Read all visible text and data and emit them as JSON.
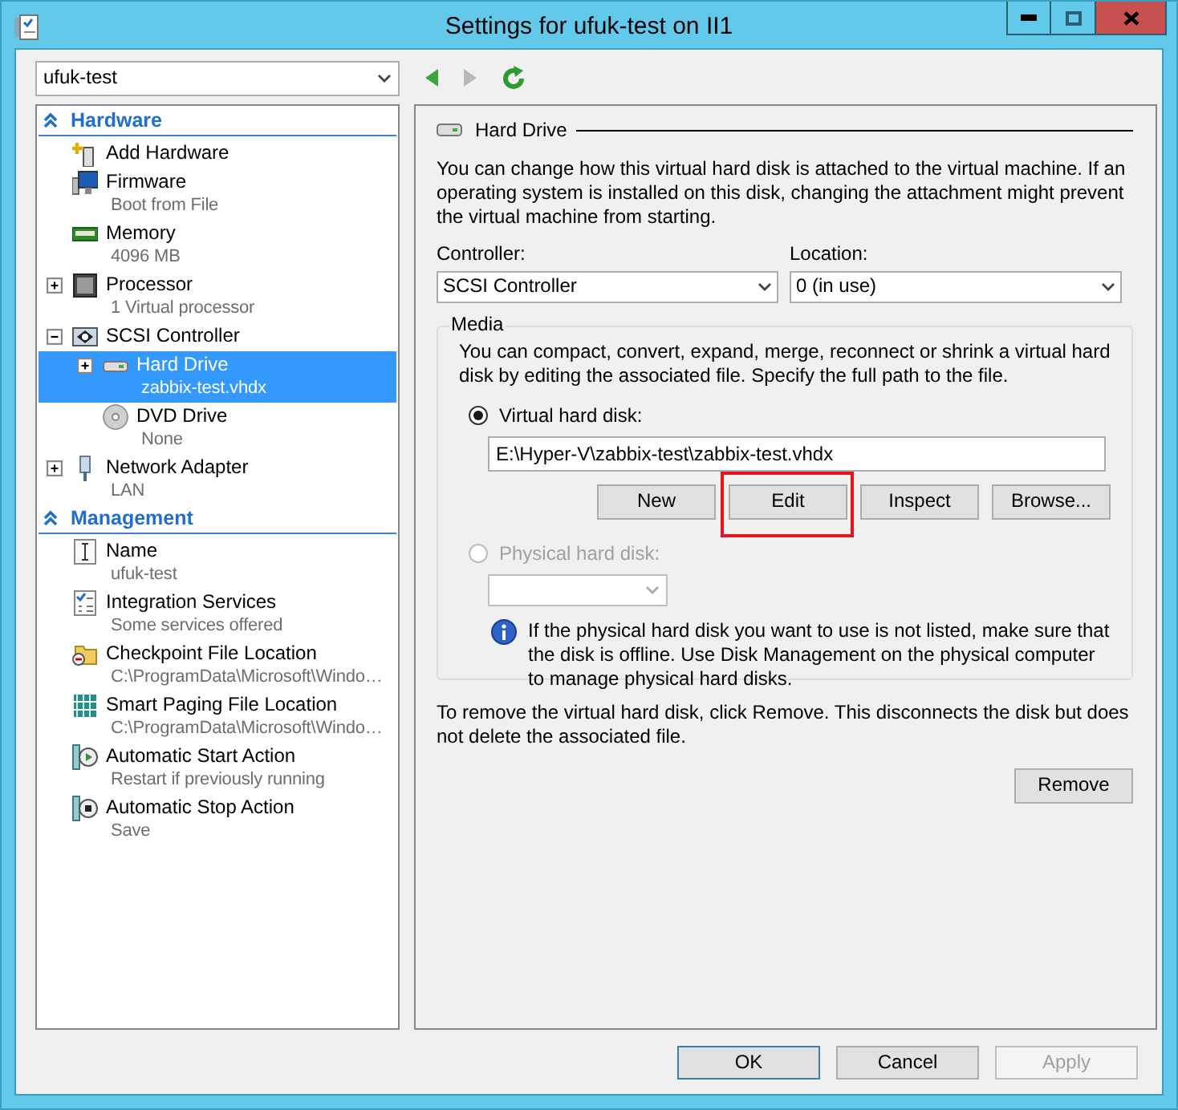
{
  "window": {
    "title": "Settings for ufuk-test on II1"
  },
  "vm_select": {
    "value": "ufuk-test"
  },
  "toolbar": {
    "back": {
      "disabled": false
    },
    "forward": {
      "disabled": true
    }
  },
  "sidebar": {
    "sections": [
      {
        "title": "Hardware",
        "expanded": true,
        "items": [
          {
            "label": "Add Hardware",
            "selected": false
          },
          {
            "label": "Firmware",
            "detail": "Boot from File",
            "selected": false
          },
          {
            "label": "Memory",
            "detail": "4096 MB",
            "selected": false
          },
          {
            "label": "Processor",
            "detail": "1 Virtual processor",
            "expanded": false,
            "selected": false
          },
          {
            "label": "SCSI Controller",
            "expanded": true,
            "selected": false,
            "children": [
              {
                "label": "Hard Drive",
                "detail": "zabbix-test.vhdx",
                "expanded": false,
                "selected": true
              },
              {
                "label": "DVD Drive",
                "detail": "None",
                "selected": false
              }
            ]
          },
          {
            "label": "Network Adapter",
            "detail": "LAN",
            "expanded": false,
            "selected": false
          }
        ]
      },
      {
        "title": "Management",
        "expanded": true,
        "items": [
          {
            "label": "Name",
            "detail": "ufuk-test",
            "selected": false
          },
          {
            "label": "Integration Services",
            "detail": "Some services offered",
            "selected": false
          },
          {
            "label": "Checkpoint File Location",
            "detail": "C:\\ProgramData\\Microsoft\\Windo…",
            "selected": false
          },
          {
            "label": "Smart Paging File Location",
            "detail": "C:\\ProgramData\\Microsoft\\Windo…",
            "selected": false
          },
          {
            "label": "Automatic Start Action",
            "detail": "Restart if previously running",
            "selected": false
          },
          {
            "label": "Automatic Stop Action",
            "detail": "Save",
            "selected": false
          }
        ]
      }
    ]
  },
  "panel": {
    "title": "Hard Drive",
    "description": "You can change how this virtual hard disk is attached to the virtual machine. If an operating system is installed on this disk, changing the attachment might prevent the virtual machine from starting.",
    "controller": {
      "label": "Controller:",
      "value": "SCSI Controller"
    },
    "location": {
      "label": "Location:",
      "value": "0 (in use)"
    },
    "media": {
      "title": "Media",
      "description": "You can compact, convert, expand, merge, reconnect or shrink a virtual hard disk by editing the associated file. Specify the full path to the file.",
      "options": [
        {
          "label": "Virtual hard disk:",
          "selected": true,
          "disabled": false
        },
        {
          "label": "Physical hard disk:",
          "selected": false,
          "disabled": true
        }
      ],
      "path": "E:\\Hyper-V\\zabbix-test\\zabbix-test.vhdx",
      "buttons": [
        {
          "label": "New"
        },
        {
          "label": "Edit",
          "highlighted": true
        },
        {
          "label": "Inspect"
        },
        {
          "label": "Browse..."
        }
      ],
      "physical_select": {
        "disabled": true
      },
      "info": "If the physical hard disk you want to use is not listed, make sure that the disk is offline. Use Disk Management on the physical computer to manage physical hard disks."
    },
    "remove_text": "To remove the virtual hard disk, click Remove. This disconnects the disk but does not delete the associated file.",
    "remove_button": "Remove"
  },
  "footer_buttons": [
    {
      "label": "OK",
      "default": true,
      "disabled": false
    },
    {
      "label": "Cancel",
      "default": false,
      "disabled": false
    },
    {
      "label": "Apply",
      "default": false,
      "disabled": true
    }
  ]
}
